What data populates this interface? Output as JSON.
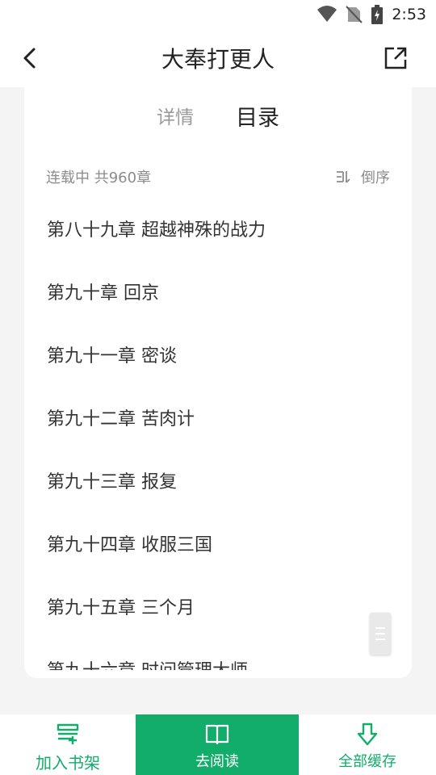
{
  "status_bar": {
    "time": "2:53"
  },
  "header": {
    "title": "大奉打更人"
  },
  "tabs": {
    "details": "详情",
    "catalog": "目录"
  },
  "catalog_info": {
    "status": "连载中 共960章",
    "sort_label": "倒序"
  },
  "chapters": [
    "第八十九章 超越神殊的战力",
    "第九十章 回京",
    "第九十一章 密谈",
    "第九十二章 苦肉计",
    "第九十三章 报复",
    "第九十四章 收服三国",
    "第九十五章 三个月",
    "第九十六章 时间管理大师"
  ],
  "bottom_bar": {
    "add_shelf": "加入书架",
    "read": "去阅读",
    "cache_all": "全部缓存"
  },
  "colors": {
    "accent": "#13ad6b"
  }
}
